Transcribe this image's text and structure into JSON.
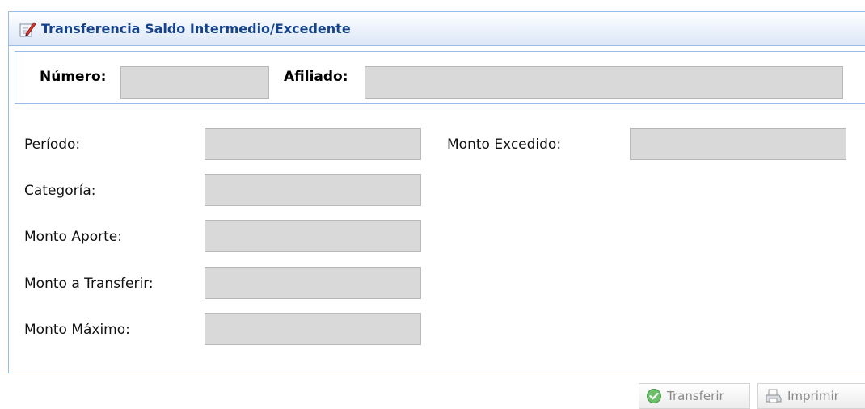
{
  "panel": {
    "title": "Transferencia Saldo Intermedio/Excedente"
  },
  "header_fields": {
    "numero": {
      "label": "Número:",
      "value": ""
    },
    "afiliado": {
      "label": "Afiliado:",
      "value": ""
    }
  },
  "form": {
    "periodo": {
      "label": "Período:",
      "value": ""
    },
    "categoria": {
      "label": "Categoría:",
      "value": ""
    },
    "monto_aporte": {
      "label": "Monto Aporte:",
      "value": ""
    },
    "monto_a_transferir": {
      "label": "Monto a Transferir:",
      "value": ""
    },
    "monto_maximo": {
      "label": "Monto Máximo:",
      "value": ""
    },
    "monto_excedido": {
      "label": "Monto Excedido:",
      "value": ""
    }
  },
  "buttons": {
    "transferir": {
      "label": "Transferir",
      "icon": "check-circle-icon",
      "enabled": false
    },
    "imprimir": {
      "label": "Imprimir",
      "icon": "printer-icon",
      "enabled": false
    }
  },
  "colors": {
    "panel_border": "#99bbe8",
    "title_text": "#15428b",
    "field_bg": "#d9d9d9",
    "transferir_icon": "#5cb85c"
  }
}
